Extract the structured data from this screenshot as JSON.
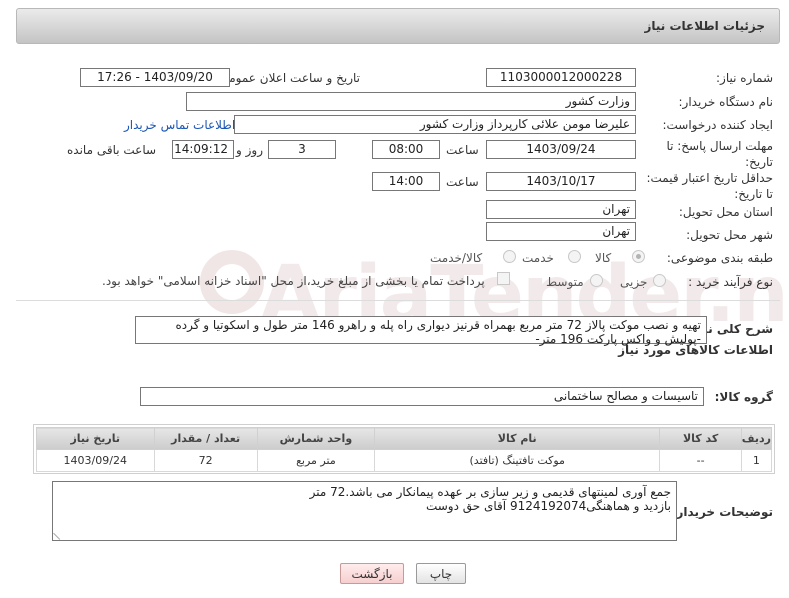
{
  "header": {
    "title": "جزئیات اطلاعات نیاز"
  },
  "labels": {
    "need_number": "شماره نیاز:",
    "announce_datetime": "تاریخ و ساعت اعلان عمومی:",
    "buyer_org": "نام دستگاه خریدار:",
    "requester": "ایجاد کننده درخواست:",
    "reply_deadline": "مهلت ارسال پاسخ: تا تاریخ:",
    "time": "ساعت",
    "days_and": "روز و",
    "time_left": "ساعت باقی مانده",
    "price_validity": "حداقل تاریخ اعتبار قیمت: تا تاریخ:",
    "province": "استان محل تحویل:",
    "city": "شهر محل تحویل:",
    "category": "طبقه بندی موضوعی:",
    "purchase_type": "نوع فرآیند خرید :",
    "general_desc": "شرح کلی نیاز:",
    "goods_info": "اطلاعات کالاهای مورد نیاز",
    "goods_group": "گروه کالا:",
    "buyer_notes": "توضیحات خریدار:"
  },
  "values": {
    "need_number": "1103000012000228",
    "announce_datetime": "1403/09/20 - 17:26",
    "buyer_org": "وزارت کشور",
    "requester": "علیرضا مومن علائی کارپرداز وزارت کشور",
    "contact_link": "اطلاعات تماس خریدار",
    "reply_date": "1403/09/24",
    "reply_time": "08:00",
    "days": "3",
    "remaining": "14:09:12",
    "validity_date": "1403/10/17",
    "validity_time": "14:00",
    "province": "تهران",
    "city": "تهران",
    "general_desc": "تهیه و نصب موکت پالاز 72 متر مربع بهمراه قرنیز دیواری راه پله و راهرو 146 متر طول و اسکوتیا و گرده -پولیش و واکس پارکت 196 متر-",
    "goods_group": "تاسیسات و مصالح ساختمانی",
    "buyer_notes_line1": "جمع آوری لمینتهای قدیمی و زیر سازی بر عهده پیمانکار می باشد.72 متر",
    "buyer_notes_line2": "بازدید و هماهنگی9124192074 آقای حق دوست"
  },
  "category_options": [
    {
      "label": "کالا",
      "selected": true
    },
    {
      "label": "خدمت",
      "selected": false
    },
    {
      "label": "کالا/خدمت",
      "selected": false
    }
  ],
  "purchase_options": [
    {
      "label": "جزیی",
      "selected": false
    },
    {
      "label": "متوسط",
      "selected": false
    }
  ],
  "payment_note": "پرداخت تمام یا بخشی از مبلغ خرید،از محل \"اسناد خزانه اسلامی\" خواهد بود.",
  "table": {
    "headers": [
      "ردیف",
      "کد کالا",
      "نام کالا",
      "واحد شمارش",
      "تعداد / مقدار",
      "تاریخ نیاز"
    ],
    "rows": [
      [
        "1",
        "--",
        "موکت تافتینگ (تافتد)",
        "متر مربع",
        "72",
        "1403/09/24"
      ]
    ]
  },
  "buttons": {
    "print": "چاپ",
    "back": "بازگشت"
  },
  "watermark_text": "AriaTender.neT"
}
